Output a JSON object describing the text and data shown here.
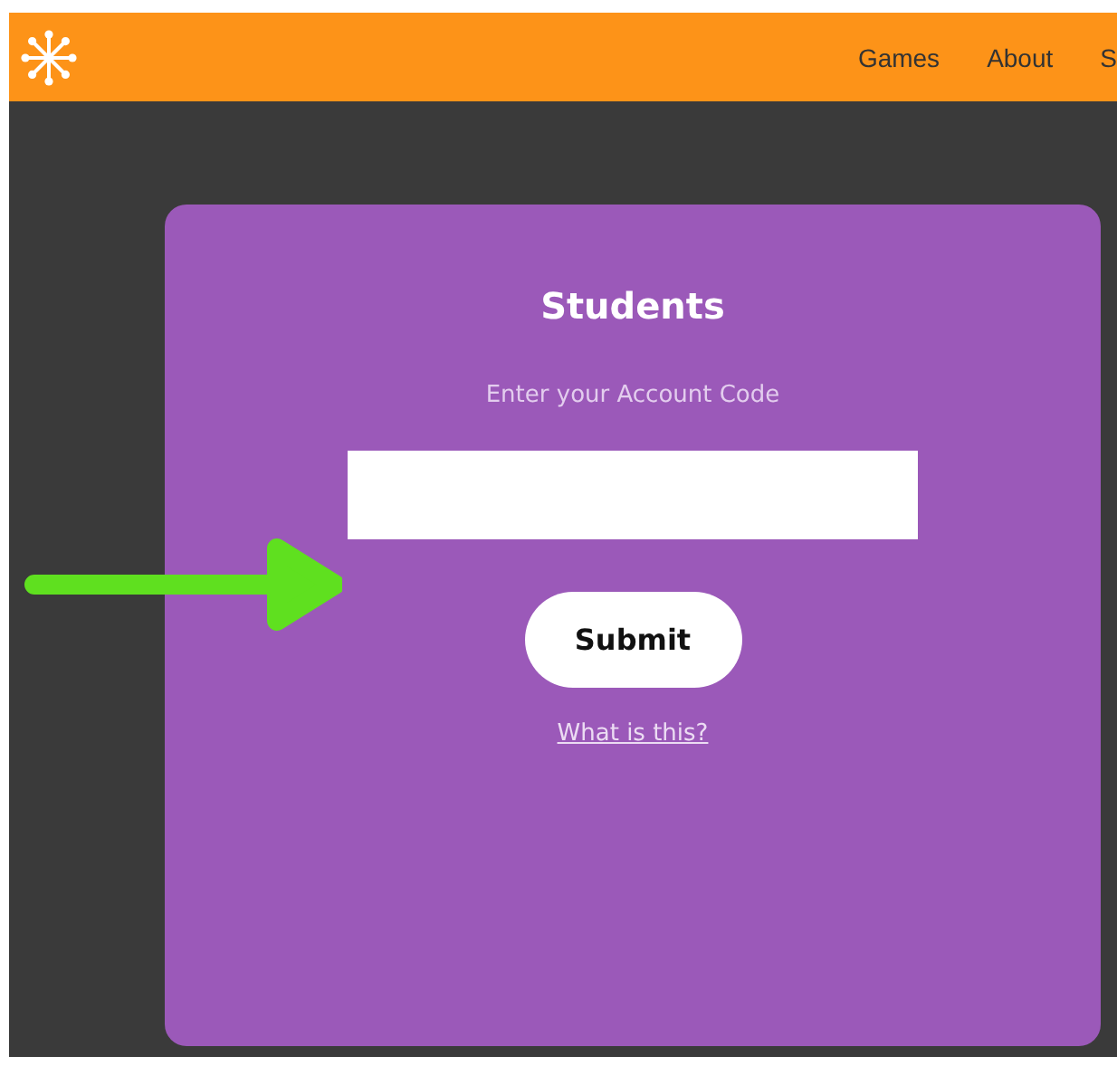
{
  "header": {
    "nav": [
      "Games",
      "About",
      "S"
    ]
  },
  "card": {
    "title": "Students",
    "label": "Enter your Account Code",
    "button": "Submit",
    "link": "What is this?"
  }
}
